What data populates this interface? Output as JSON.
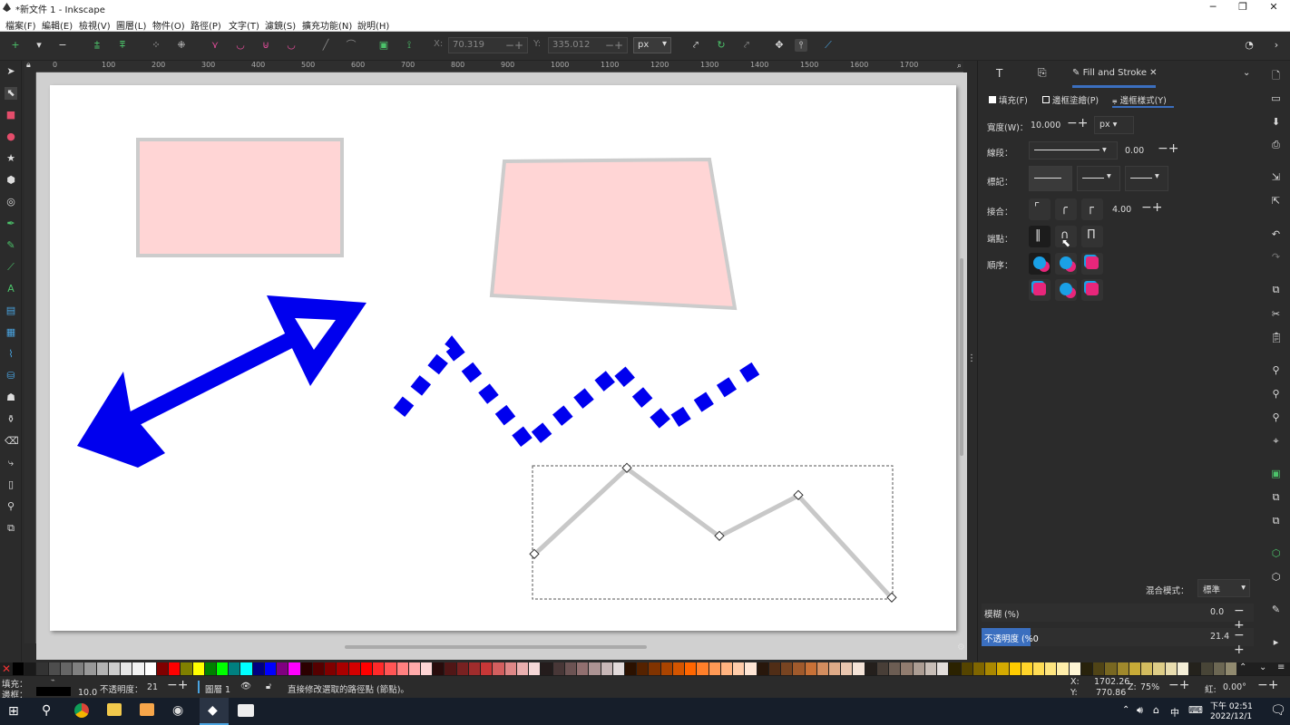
{
  "window": {
    "title": "*新文件 1 - Inkscape",
    "min": "─",
    "max": "❐",
    "close": "✕"
  },
  "menu": [
    "檔案(F)",
    "編輯(E)",
    "檢視(V)",
    "圖層(L)",
    "物件(O)",
    "路徑(P)",
    "文字(T)",
    "濾鏡(S)",
    "擴充功能(N)",
    "說明(H)"
  ],
  "toolbar": {
    "x_label": "X:",
    "x_value": "70.319",
    "y_label": "Y:",
    "y_value": "335.012",
    "unit": "px"
  },
  "ruler_numbers": [
    "0",
    "100",
    "200",
    "300",
    "400",
    "500",
    "600",
    "700",
    "800",
    "900",
    "1000",
    "1100",
    "1200",
    "1300",
    "1400",
    "1500",
    "1600",
    "1700"
  ],
  "panel": {
    "tab_text": "T",
    "tab_active": "Fill and Stroke",
    "tab_close": "✕",
    "subtab_fill": "填充(F)",
    "subtab_stroke_paint": "邊框塗繪(P)",
    "subtab_stroke_style": "邊框樣式(Y)",
    "width_label": "寬度(W)：",
    "width_value": "10.000",
    "width_unit": "px",
    "dash_label": "線段：",
    "dash_offset": "0.00",
    "markers_label": "標記：",
    "join_label": "接合：",
    "miter_value": "4.00",
    "cap_label": "端點：",
    "order_label": "順序：",
    "blend_label": "混合模式：",
    "blend_value": "標準",
    "blur_label": "模糊 (%)",
    "blur_value": "0.0",
    "opacity_label": "不透明度 (%0",
    "opacity_value": "21.4",
    "opacity_fill": 0.214
  },
  "status": {
    "fill_label": "填充：",
    "stroke_label": "邊框：",
    "stroke_width": "10.0",
    "opacity_label": "不透明度：",
    "opacity_value": "21",
    "layer": "圖層 1",
    "message": "直接修改選取的路徑點 (節點)。",
    "x_label": "X:",
    "x_value": "1702.26",
    "y_label": "Y:",
    "y_value": "770.86",
    "zoom_label": "Z:",
    "zoom_value": "75%",
    "rot_label": "紅:",
    "rot_value": "0.00°"
  },
  "taskbar": {
    "time": "下午 02:51",
    "date": "2022/12/1",
    "lang": "中"
  },
  "colors": {
    "accent_blue": "#0000ee",
    "rect_fill": "#ffd5d5",
    "rect_stroke": "#cccccc",
    "line_stroke": "#c8c8c8",
    "panel_highlight": "#3b6fbf"
  }
}
